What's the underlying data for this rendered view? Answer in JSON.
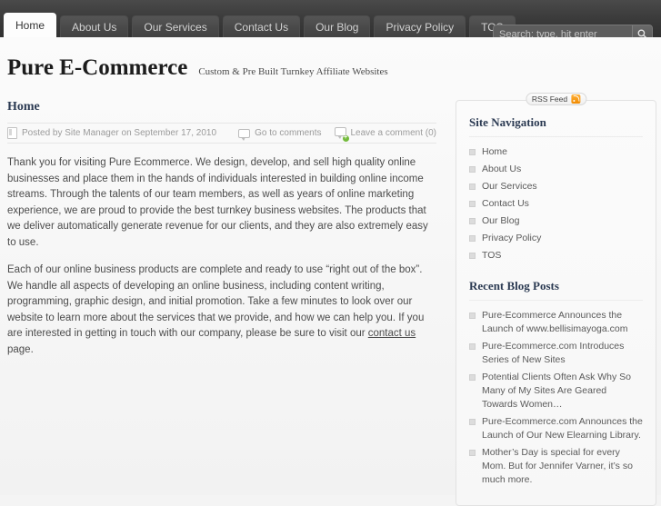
{
  "header": {
    "nav": [
      {
        "label": "Home",
        "active": true
      },
      {
        "label": "About Us",
        "active": false
      },
      {
        "label": "Our Services",
        "active": false
      },
      {
        "label": "Contact Us",
        "active": false
      },
      {
        "label": "Our Blog",
        "active": false
      },
      {
        "label": "Privacy Policy",
        "active": false
      },
      {
        "label": "TOS",
        "active": false
      }
    ],
    "search": {
      "placeholder": "Search: type, hit enter",
      "value": "",
      "button_icon": "search-icon"
    }
  },
  "branding": {
    "title": "Pure E-Commerce",
    "tagline": "Custom & Pre Built Turnkey Affiliate Websites"
  },
  "main": {
    "entry_title": "Home",
    "meta": {
      "posted": "Posted by Site Manager on September 17, 2010",
      "go_to_comments": "Go to comments",
      "leave_comment": "Leave a comment (0)"
    },
    "paragraphs": [
      {
        "before": "Thank you for visiting Pure Ecommerce. We design, develop, and sell high quality online businesses and place them in the hands of individuals interested in building online income streams. Through the talents of our team members, as well as years of online marketing experience, we are proud to provide the best turnkey business websites. The products that we deliver automatically generate revenue for our clients, and they are also extremely easy to use.",
        "link": "",
        "after": ""
      },
      {
        "before": "Each of our online business products are complete and ready to use “right out of the box”. We handle all aspects of developing an online business, including content writing, programming, graphic design, and initial promotion. Take a few minutes to look over our website to learn more about the services that we provide, and how we can help you. If you are interested in getting in touch with our company, please be sure to visit our ",
        "link": "contact us",
        "after": " page."
      }
    ]
  },
  "sidebar": {
    "rss": {
      "label": "RSS Feed",
      "icon": "rss-icon"
    },
    "widgets": [
      {
        "title": "Site Navigation",
        "items": [
          "Home",
          "About Us",
          "Our Services",
          "Contact Us",
          "Our Blog",
          "Privacy Policy",
          "TOS"
        ]
      },
      {
        "title": "Recent Blog Posts",
        "items": [
          "Pure-Ecommerce Announces the Launch of www.bellisimayoga.com",
          "Pure-Ecommerce.com Introduces Series of New Sites",
          "Potential Clients Often Ask Why So Many of My Sites Are Geared Towards Women…",
          "Pure-Ecommerce.com Announces the Launch of Our New Elearning Library.",
          "Mother’s Day is special for every Mom. But for Jennifer Varner, it’s so much more."
        ]
      }
    ]
  },
  "colors": {
    "header_bg": "#3c3c3c",
    "page_bg": "#f7f7f7",
    "heading": "#2b3a52",
    "text": "#4c4c4c",
    "rss_orange": "#f08a00",
    "accent_green": "#74bb3c"
  }
}
